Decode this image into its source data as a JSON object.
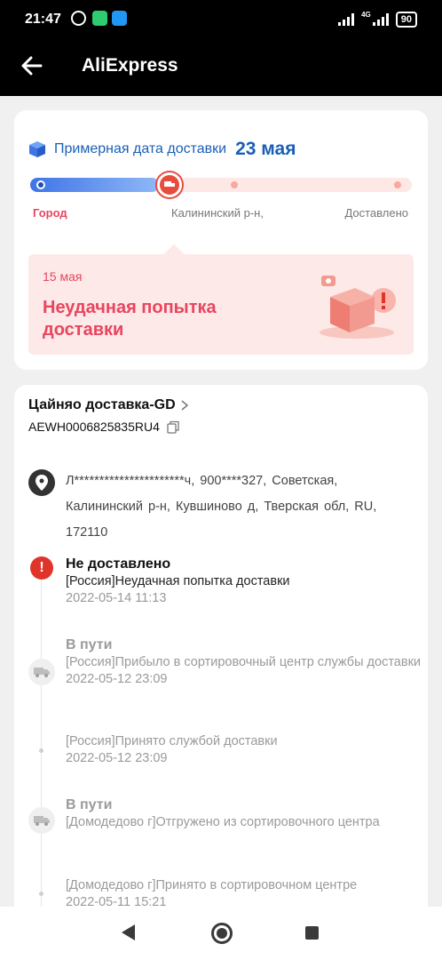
{
  "status_bar": {
    "time": "21:47",
    "network": "4G",
    "battery": "90"
  },
  "app_bar": {
    "title": "AliExpress"
  },
  "delivery_estimate": {
    "label": "Примерная дата доставки",
    "date": "23 мая"
  },
  "progress": {
    "stages": [
      "Город",
      "Калининский р-н,",
      "Доставлено"
    ]
  },
  "alert": {
    "date": "15 мая",
    "title": "Неудачная попытка доставки"
  },
  "shipment": {
    "carrier": "Цайняо доставка-GD",
    "tracking_number": "AEWH0006825835RU4",
    "address": "Л**********************ч,  900****327,  Советская,  Калининский р-н, Кувшиново д,  Тверская обл,  RU,  172110"
  },
  "events": [
    {
      "title": "Не доставлено",
      "desc": "[Россия]Неудачная попытка доставки",
      "time": "2022-05-14 11:13"
    },
    {
      "title": "В пути",
      "desc": "[Россия]Прибыло в сортировочный центр службы доставки",
      "time": "2022-05-12 23:09"
    },
    {
      "title": "",
      "desc": "[Россия]Принято службой доставки",
      "time": "2022-05-12 23:09"
    },
    {
      "title": "В пути",
      "desc": "[Домодедово г]Отгружено из сортировочного центра",
      "time": ""
    },
    {
      "title": "",
      "desc": "[Домодедово г]Принято в сортировочном центре",
      "time": "2022-05-11 15:21"
    }
  ],
  "colors": {
    "accent_blue": "#1b5fb5",
    "alert_red": "#e8455f",
    "error_red": "#e0342a"
  }
}
